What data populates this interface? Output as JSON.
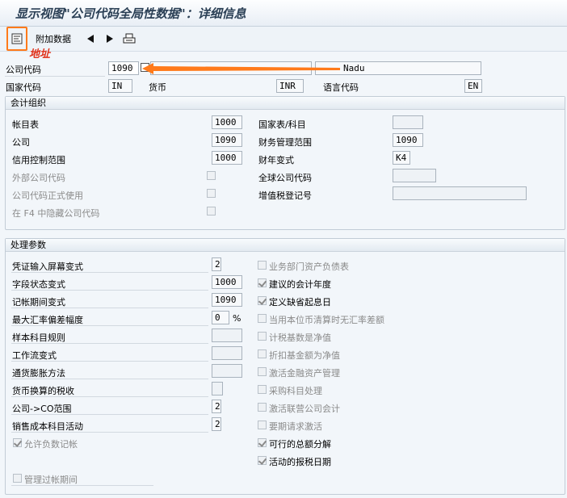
{
  "title": "显示视图\"公司代码全局性数据\"：详细信息",
  "toolbar": {
    "additional_data": "附加数据",
    "annotation": "地址"
  },
  "header": {
    "company_code_label": "公司代码",
    "company_code_value": "1090",
    "company_name_right": "Nadu",
    "country_label": "国家代码",
    "country_value": "IN",
    "currency_label": "货币",
    "currency_value": "INR",
    "language_label": "语言代码",
    "language_value": "EN"
  },
  "accounting_org": {
    "title": "会计组织",
    "chart_of_accounts_label": "帐目表",
    "chart_of_accounts_value": "1000",
    "company_label": "公司",
    "company_value": "1090",
    "credit_control_label": "信用控制范围",
    "credit_control_value": "1000",
    "external_cc_label": "外部公司代码",
    "cc_productive_label": "公司代码正式使用",
    "hide_f4_label": "在 F4 中隐藏公司代码",
    "country_coa_label": "国家表/科目",
    "fm_area_label": "财务管理范围",
    "fm_area_value": "1090",
    "fiscal_variant_label": "财年变式",
    "fiscal_variant_value": "K4",
    "global_cc_label": "全球公司代码",
    "vat_reg_label": "增值税登记号"
  },
  "processing": {
    "title": "处理参数",
    "left": [
      {
        "label": "凭证输入屏幕变式",
        "value": "2"
      },
      {
        "label": "字段状态变式",
        "value": "1000"
      },
      {
        "label": "记帐期间变式",
        "value": "1090"
      },
      {
        "label": "最大汇率偏差幅度",
        "value": "0",
        "unit": "%"
      },
      {
        "label": "样本科目规则",
        "value": ""
      },
      {
        "label": "工作流变式",
        "value": ""
      },
      {
        "label": "通货膨胀方法",
        "value": ""
      },
      {
        "label": "货币换算的税收",
        "value": ""
      },
      {
        "label": "公司->CO范围",
        "value": "2"
      },
      {
        "label": "销售成本科目活动",
        "value": "2"
      }
    ],
    "allow_negative_label": "允许负数记帐",
    "manage_periods_label": "管理过帐期间",
    "right": [
      {
        "label": "业务部门资产负债表",
        "checked": false
      },
      {
        "label": "建议的会计年度",
        "checked": true
      },
      {
        "label": "定义缺省起息日",
        "checked": true
      },
      {
        "label": "当用本位币清算时无汇率差额",
        "checked": false
      },
      {
        "label": "计税基数是净值",
        "checked": false
      },
      {
        "label": "折扣基金额为净值",
        "checked": false
      },
      {
        "label": "激活金融资产管理",
        "checked": false
      },
      {
        "label": "采购科目处理",
        "checked": false
      },
      {
        "label": "激活联营公司会计",
        "checked": false
      },
      {
        "label": "要期请求激活",
        "checked": false
      },
      {
        "label": "可行的总额分解",
        "checked": true
      },
      {
        "label": "活动的报税日期",
        "checked": true
      }
    ]
  }
}
